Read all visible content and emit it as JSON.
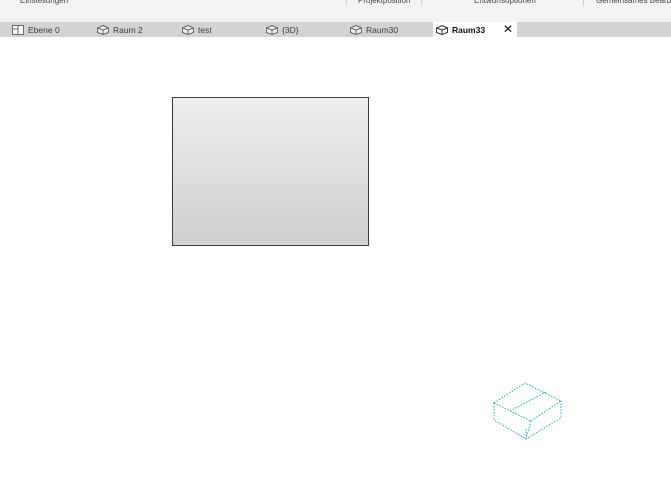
{
  "ribbon": {
    "groups": [
      "Einstellungen",
      "Projektposition",
      "Entwurfsoptionen",
      "Gemeinsames Bearbe"
    ]
  },
  "tabs": [
    {
      "label": "Ebene 0",
      "icon": "floor-plan-icon",
      "active": false
    },
    {
      "label": "Raum 2",
      "icon": "3d-view-icon",
      "active": false
    },
    {
      "label": "test",
      "icon": "3d-view-icon",
      "active": false
    },
    {
      "label": "{3D}",
      "icon": "3d-view-icon",
      "active": false
    },
    {
      "label": "Raum30",
      "icon": "3d-view-icon",
      "active": false
    },
    {
      "label": "Raum33",
      "icon": "3d-view-icon",
      "active": true,
      "close": "✕"
    }
  ],
  "colors": {
    "tabbar": "#d3d3d3",
    "active_tab": "#ffffff",
    "wireframe": "#2aa6b8"
  }
}
